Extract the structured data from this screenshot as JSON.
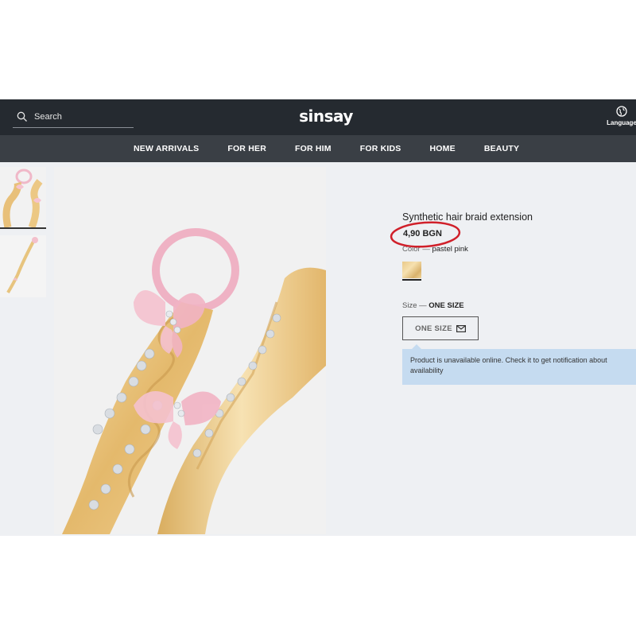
{
  "header": {
    "search_placeholder": "Search",
    "logo": "sinsay",
    "language_label": "Language"
  },
  "nav": {
    "items": [
      "NEW ARRIVALS",
      "FOR HER",
      "FOR HIM",
      "FOR KIDS",
      "HOME",
      "BEAUTY"
    ]
  },
  "product": {
    "title": "Synthetic hair braid extension",
    "price": "4,90 BGN",
    "color_label": "Color — ",
    "color_value": "pastel pink",
    "size_label": "Size — ",
    "size_value": "ONE SIZE",
    "size_button": "ONE SIZE",
    "notice": "Product is unavailable online. Check it to get notification about availability"
  },
  "colors": {
    "header_bg": "#252a30",
    "nav_bg": "#3a3f45",
    "content_bg": "#eef0f3",
    "notice_bg": "#c5dbf0",
    "annotation": "#d0202a"
  },
  "icons": {
    "search": "search-icon",
    "language": "globe-icon",
    "mail": "mail-icon"
  }
}
